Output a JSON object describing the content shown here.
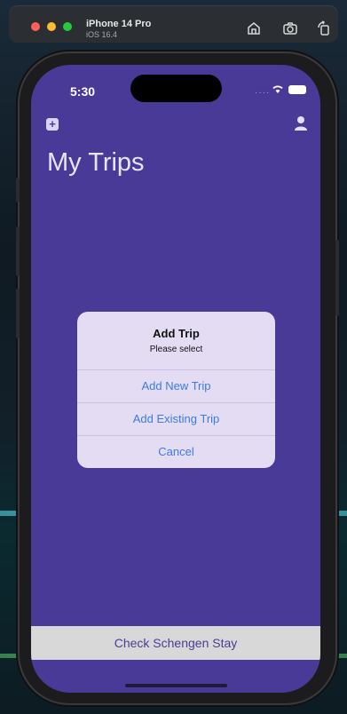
{
  "simulator": {
    "device_name": "iPhone 14 Pro",
    "os_version": "iOS 16.4",
    "toolbar_icons": [
      "home-icon",
      "screenshot-icon",
      "rotate-icon"
    ]
  },
  "status_bar": {
    "time": "5:30",
    "icons": [
      "wifi-icon",
      "battery-icon"
    ]
  },
  "nav": {
    "left_icon": "add-icon",
    "right_icon": "profile-icon",
    "title": "My Trips"
  },
  "alert": {
    "title": "Add Trip",
    "message": "Please select",
    "actions": [
      "Add New Trip",
      "Add Existing Trip",
      "Cancel"
    ]
  },
  "bottom_button": {
    "label": "Check Schengen Stay"
  },
  "colors": {
    "screen_background": "#4a3a98",
    "alert_background": "#e3dcf3",
    "action_text": "#3c7ce0",
    "bottom_button_background": "#d8d8d8"
  }
}
